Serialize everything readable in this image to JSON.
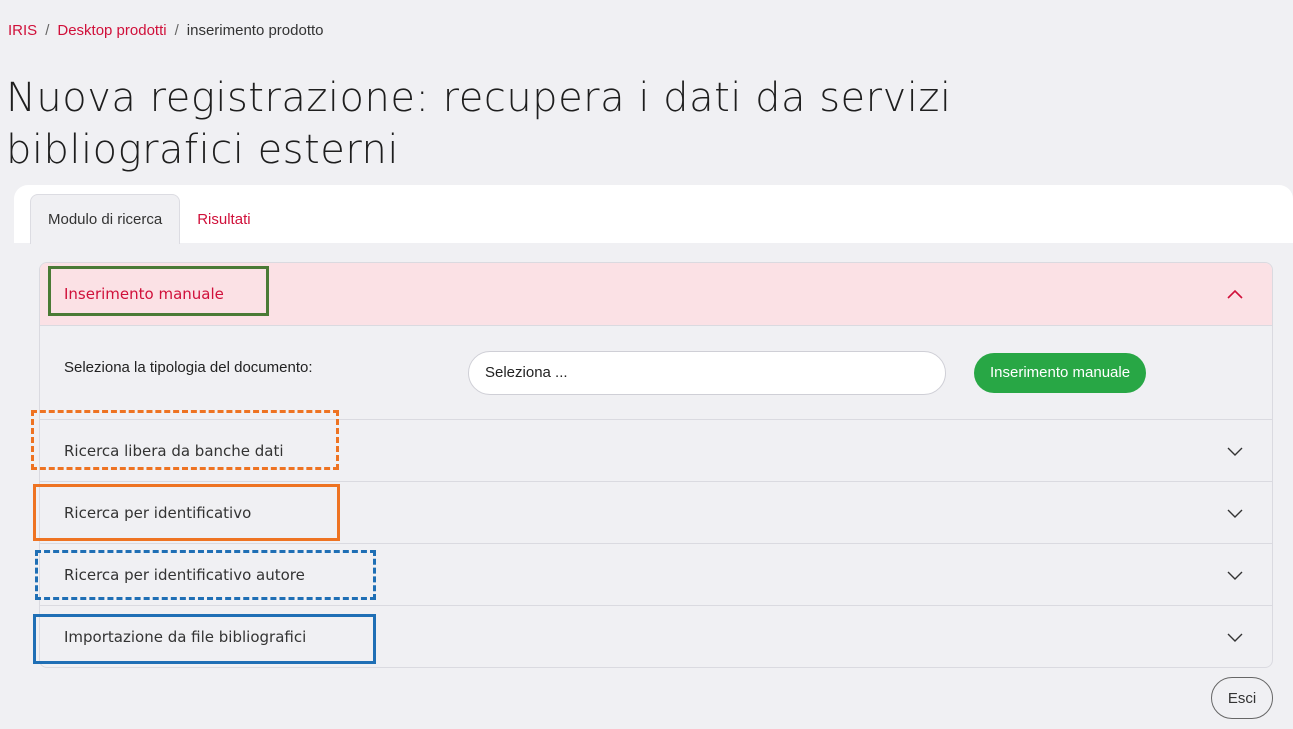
{
  "breadcrumb": {
    "root": "IRIS",
    "desktop": "Desktop prodotti",
    "current": "inserimento prodotto",
    "separator": "/"
  },
  "page_title": "Nuova registrazione: recupera i dati da servizi bibliografici esterni",
  "tabs": [
    {
      "label": "Modulo di ricerca",
      "active": true
    },
    {
      "label": "Risultati",
      "active": false
    }
  ],
  "accordion": {
    "manual": {
      "title": "Inserimento manuale",
      "expanded": true,
      "doc_type_label": "Seleziona la tipologia del documento:",
      "select_value": "Seleziona ...",
      "button_label": "Inserimento manuale"
    },
    "free_search": {
      "title": "Ricerca libera da banche dati",
      "expanded": false
    },
    "by_id": {
      "title": "Ricerca per identificativo",
      "expanded": false
    },
    "by_author_id": {
      "title": "Ricerca per identificativo autore",
      "expanded": false
    },
    "import_file": {
      "title": "Importazione da file bibliografici",
      "expanded": false
    }
  },
  "exit_button": "Esci",
  "icons": {
    "expanded": "chevron-up-icon",
    "collapsed": "chevron-down-icon"
  },
  "colors": {
    "accent": "#d0103a",
    "success": "#28a745",
    "highlight_green": "#4a7a35",
    "highlight_orange": "#ee7322",
    "highlight_blue": "#1f6fb5"
  }
}
